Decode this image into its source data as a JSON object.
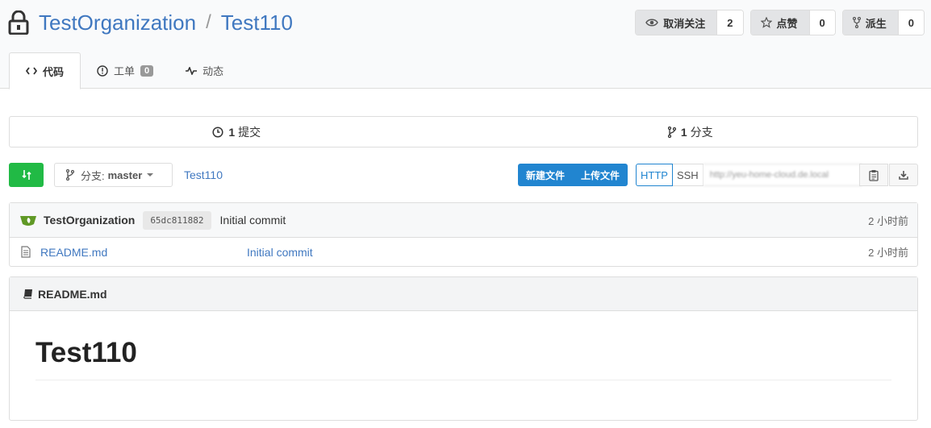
{
  "repo": {
    "owner": "TestOrganization",
    "separator": "/",
    "name": "Test110"
  },
  "actions": [
    {
      "label": "取消关注",
      "count": "2",
      "icon": "eye-icon"
    },
    {
      "label": "点赞",
      "count": "0",
      "icon": "star-icon"
    },
    {
      "label": "派生",
      "count": "0",
      "icon": "fork-icon"
    }
  ],
  "tabs": [
    {
      "label": "代码",
      "icon": "code-icon",
      "active": true
    },
    {
      "label": "工单",
      "icon": "issue-icon",
      "badge": "0"
    },
    {
      "label": "动态",
      "icon": "pulse-icon"
    }
  ],
  "stats": {
    "commits_count": "1",
    "commits_label": "提交",
    "branches_count": "1",
    "branches_label": "分支"
  },
  "toolbar": {
    "branch_prefix": "分支:",
    "branch": "master",
    "breadcrumb": "Test110",
    "new_file": "新建文件",
    "upload_file": "上传文件",
    "http": "HTTP",
    "ssh": "SSH",
    "clone_url": "http://yeu-home-cloud.de.local"
  },
  "latest_commit": {
    "author": "TestOrganization",
    "sha": "65dc811882",
    "message": "Initial commit",
    "time": "2 小时前"
  },
  "files": [
    {
      "name": "README.md",
      "commit": "Initial commit",
      "time": "2 小时前"
    }
  ],
  "readme": {
    "filename": "README.md",
    "heading": "Test110"
  },
  "colors": {
    "link": "#4078c0",
    "primary": "#2185d0",
    "green": "#21ba45"
  }
}
